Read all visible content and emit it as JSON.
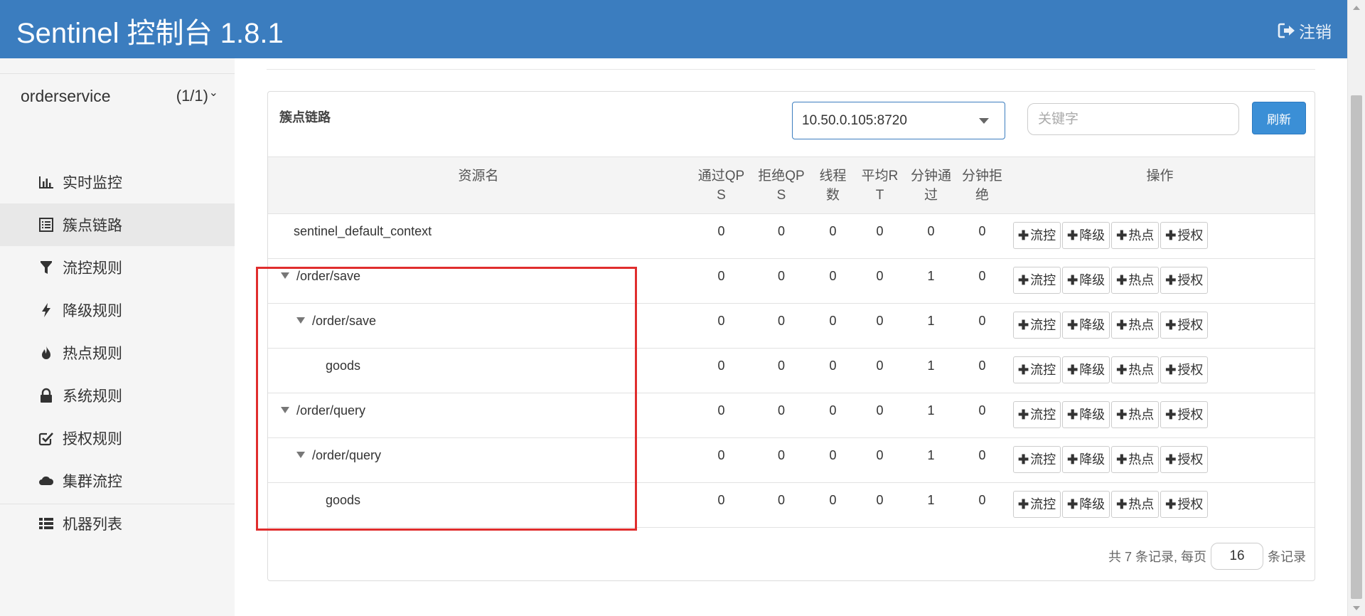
{
  "header": {
    "title": "Sentinel 控制台 1.8.1",
    "logout_label": "注销",
    "logout_icon": "sign-out-icon"
  },
  "sidebar": {
    "app_name": "orderservice",
    "app_count": "(1/1)",
    "expand_icon": "chevron-down-icon",
    "items": [
      {
        "label": "实时监控",
        "icon": "bar-chart-icon"
      },
      {
        "label": "簇点链路",
        "icon": "list-alt-icon",
        "active": true
      },
      {
        "label": "流控规则",
        "icon": "filter-icon"
      },
      {
        "label": "降级规则",
        "icon": "flash-icon"
      },
      {
        "label": "热点规则",
        "icon": "fire-icon"
      },
      {
        "label": "系统规则",
        "icon": "lock-icon"
      },
      {
        "label": "授权规则",
        "icon": "check-square-icon"
      },
      {
        "label": "集群流控",
        "icon": "cloud-icon"
      },
      {
        "label": "机器列表",
        "icon": "th-list-icon"
      }
    ]
  },
  "panel": {
    "title": "簇点链路",
    "machine": "10.50.0.105:8720",
    "keyword_placeholder": "关键字",
    "refresh_label": "刷新"
  },
  "table": {
    "headers": {
      "resource": "资源名",
      "pass_qps_1": "通过QP",
      "pass_qps_2": "S",
      "block_qps_1": "拒绝QP",
      "block_qps_2": "S",
      "threads_1": "线程",
      "threads_2": "数",
      "avg_rt_1": "平均R",
      "avg_rt_2": "T",
      "min_pass_1": "分钟通",
      "min_pass_2": "过",
      "min_block_1": "分钟拒",
      "min_block_2": "绝",
      "ops": "操作"
    },
    "op_labels": {
      "flow": "流控",
      "degrade": "降级",
      "hot": "热点",
      "auth": "授权"
    },
    "rows": [
      {
        "name": "sentinel_default_context",
        "pass": "0",
        "block": "0",
        "threads": "0",
        "rt": "0",
        "min_pass": "0",
        "min_block": "0"
      },
      {
        "name": "/order/save",
        "pass": "0",
        "block": "0",
        "threads": "0",
        "rt": "0",
        "min_pass": "1",
        "min_block": "0"
      },
      {
        "name": "/order/save",
        "pass": "0",
        "block": "0",
        "threads": "0",
        "rt": "0",
        "min_pass": "1",
        "min_block": "0"
      },
      {
        "name": "goods",
        "pass": "0",
        "block": "0",
        "threads": "0",
        "rt": "0",
        "min_pass": "1",
        "min_block": "0"
      },
      {
        "name": "/order/query",
        "pass": "0",
        "block": "0",
        "threads": "0",
        "rt": "0",
        "min_pass": "1",
        "min_block": "0"
      },
      {
        "name": "/order/query",
        "pass": "0",
        "block": "0",
        "threads": "0",
        "rt": "0",
        "min_pass": "1",
        "min_block": "0"
      },
      {
        "name": "goods",
        "pass": "0",
        "block": "0",
        "threads": "0",
        "rt": "0",
        "min_pass": "1",
        "min_block": "0"
      }
    ]
  },
  "pagination": {
    "prefix": "共 7 条记录, 每页",
    "page_size": "16",
    "suffix": "条记录"
  },
  "colors": {
    "header_bg": "#3b7dbf",
    "primary_button": "#3b8fd6",
    "highlight_border": "#e02d2d"
  }
}
